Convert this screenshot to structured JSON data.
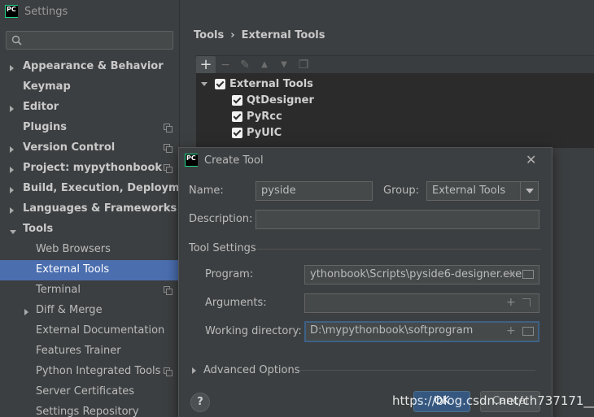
{
  "window": {
    "title": "Settings",
    "logo": "PC"
  },
  "search": {
    "placeholder": ""
  },
  "sidebar": {
    "items": [
      {
        "label": "Appearance & Behavior",
        "bold": true,
        "expand": "collapsed",
        "copy": false
      },
      {
        "label": "Keymap",
        "bold": true,
        "expand": "none",
        "copy": false
      },
      {
        "label": "Editor",
        "bold": true,
        "expand": "collapsed",
        "copy": false
      },
      {
        "label": "Plugins",
        "bold": true,
        "expand": "none",
        "copy": true
      },
      {
        "label": "Version Control",
        "bold": true,
        "expand": "collapsed",
        "copy": true
      },
      {
        "label": "Project: mypythonbook",
        "bold": true,
        "expand": "collapsed",
        "copy": true
      },
      {
        "label": "Build, Execution, Deployment",
        "bold": true,
        "expand": "collapsed",
        "copy": false
      },
      {
        "label": "Languages & Frameworks",
        "bold": true,
        "expand": "collapsed",
        "copy": false
      },
      {
        "label": "Tools",
        "bold": true,
        "expand": "expanded",
        "copy": false
      },
      {
        "label": "Web Browsers",
        "bold": false,
        "expand": "none",
        "copy": false
      },
      {
        "label": "External Tools",
        "bold": false,
        "expand": "none",
        "copy": false,
        "selected": true
      },
      {
        "label": "Terminal",
        "bold": false,
        "expand": "none",
        "copy": true
      },
      {
        "label": "Diff & Merge",
        "bold": false,
        "expand": "collapsed",
        "copy": false
      },
      {
        "label": "External Documentation",
        "bold": false,
        "expand": "none",
        "copy": false
      },
      {
        "label": "Features Trainer",
        "bold": false,
        "expand": "none",
        "copy": false
      },
      {
        "label": "Python Integrated Tools",
        "bold": false,
        "expand": "none",
        "copy": true
      },
      {
        "label": "Server Certificates",
        "bold": false,
        "expand": "none",
        "copy": false
      },
      {
        "label": "Settings Repository",
        "bold": false,
        "expand": "none",
        "copy": false
      }
    ]
  },
  "breadcrumb": {
    "parent": "Tools",
    "separator": "›",
    "current": "External Tools"
  },
  "toolbar": {
    "add": "+",
    "remove": "−",
    "edit": "✎",
    "up": "▲",
    "down": "▼",
    "copy": "❐"
  },
  "tools_tree": {
    "group": {
      "label": "External Tools",
      "checked": true
    },
    "children": [
      {
        "label": "QtDesigner",
        "checked": true
      },
      {
        "label": "PyRcc",
        "checked": true
      },
      {
        "label": "PyUIC",
        "checked": true
      }
    ]
  },
  "dialog": {
    "title": "Create Tool",
    "name_label": "Name:",
    "name_value": "pyside",
    "group_label": "Group:",
    "group_value": "External Tools",
    "description_label": "Description:",
    "description_value": "",
    "tool_settings_header": "Tool Settings",
    "program_label": "Program:",
    "program_value": "ythonbook\\Scripts\\pyside6-designer.exe",
    "arguments_label": "Arguments:",
    "arguments_value": "",
    "working_dir_label": "Working directory:",
    "working_dir_value": "D:\\mypythonbook\\softprogram",
    "advanced_label": "Advanced Options",
    "help_label": "?",
    "ok_label": "OK",
    "cancel_label": "Cancel"
  },
  "watermark": "https://blog.csdn.net/ch737171__",
  "colors": {
    "selection": "#4b6eaf",
    "accent_logo": "#21d789",
    "background": "#3c3f41",
    "ok_button": "#365880"
  }
}
